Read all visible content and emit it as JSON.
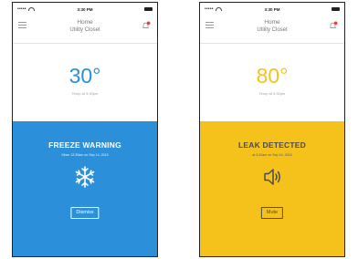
{
  "screens": [
    {
      "status": {
        "time": "3:30 PM",
        "signal": "•••••"
      },
      "nav": {
        "title": "Home",
        "subtitle": "Utility Closet",
        "menu_icon": "hamburger-menu-icon",
        "alert_icon": "alert-bell-icon"
      },
      "temperature": {
        "value": "30°",
        "caption": "Temp at 3:30pm",
        "color": "#2b8fda"
      },
      "alert": {
        "title": "FREEZE WARNING",
        "detail": "Since 12:30am on Sep 14, 2015",
        "icon": "snowflake-icon",
        "button_label": "Dismiss",
        "color": "#2b8fda"
      }
    },
    {
      "status": {
        "time": "3:30 PM",
        "signal": "•••••"
      },
      "nav": {
        "title": "Home",
        "subtitle": "Utility Closet",
        "menu_icon": "hamburger-menu-icon",
        "alert_icon": "alert-bell-icon"
      },
      "temperature": {
        "value": "80°",
        "caption": "Temp at 3:30pm",
        "color": "#f5c21c"
      },
      "alert": {
        "title": "LEAK DETECTED",
        "detail": "at 3:32am on Sep 14, 2015",
        "icon": "speaker-icon",
        "button_label": "Mute",
        "color": "#f5c21c"
      }
    }
  ]
}
